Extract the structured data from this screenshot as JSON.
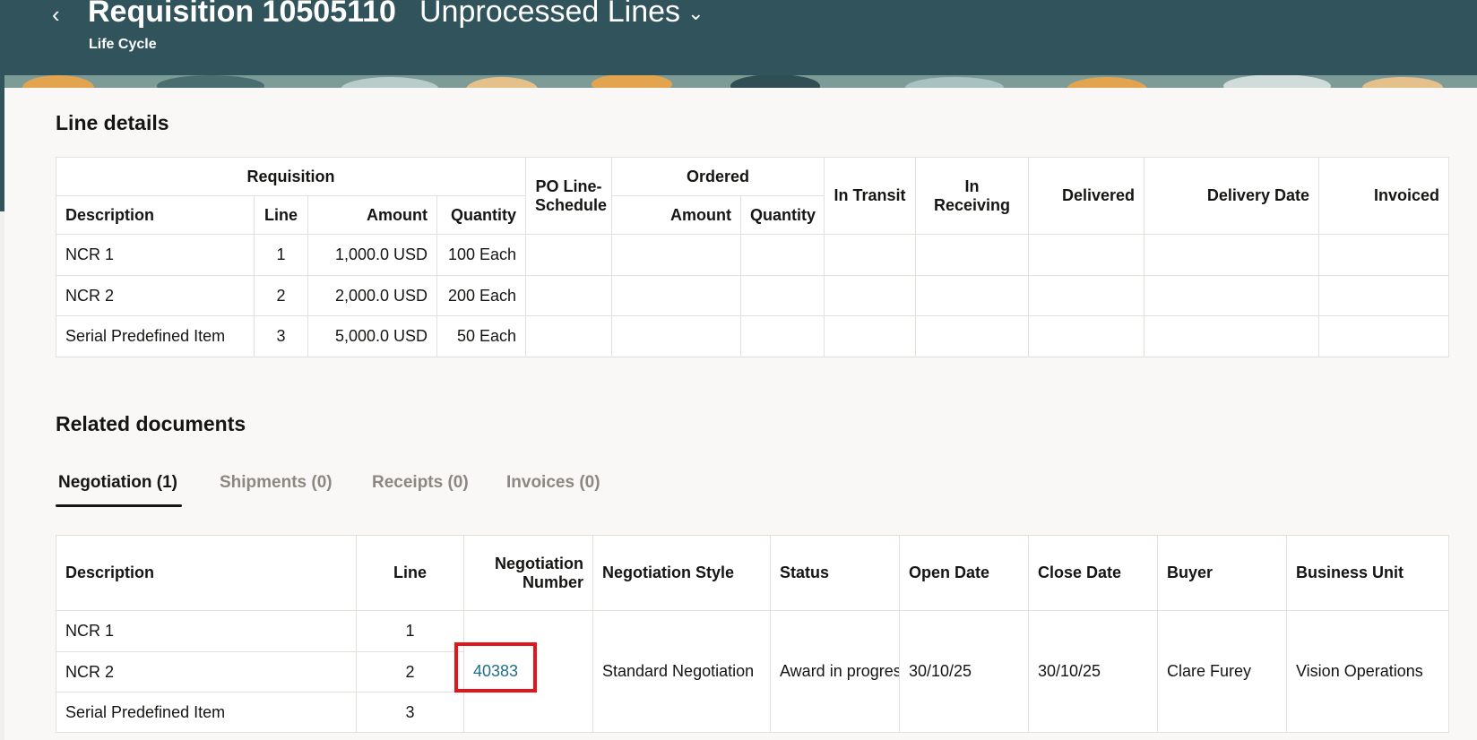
{
  "header": {
    "title": "Requisition 10505110",
    "view_selector": "Unprocessed Lines",
    "subtitle": "Life Cycle",
    "back_icon": "chevron-left-icon",
    "view_icon": "chevron-down-icon",
    "brand_color": "#31545c"
  },
  "line_details": {
    "title": "Line details",
    "group_requisition": "Requisition",
    "group_ordered": "Ordered",
    "col_description": "Description",
    "col_line": "Line",
    "col_amount": "Amount",
    "col_quantity": "Quantity",
    "col_po_line_schedule_1": "PO Line-",
    "col_po_line_schedule_2": "Schedule",
    "col_ordered_amount": "Amount",
    "col_ordered_quantity": "Quantity",
    "col_in_transit": "In Transit",
    "col_in_receiving": "In Receiving",
    "col_delivered": "Delivered",
    "col_delivery_date": "Delivery Date",
    "col_invoiced": "Invoiced",
    "rows": [
      {
        "description": "NCR 1",
        "line": "1",
        "amount": "1,000.0 USD",
        "quantity": "100 Each"
      },
      {
        "description": "NCR 2",
        "line": "2",
        "amount": "2,000.0 USD",
        "quantity": "200 Each"
      },
      {
        "description": "Serial Predefined Item",
        "line": "3",
        "amount": "5,000.0 USD",
        "quantity": "50 Each"
      }
    ]
  },
  "related": {
    "title": "Related documents",
    "tabs": [
      {
        "label": "Negotiation (1)"
      },
      {
        "label": "Shipments (0)"
      },
      {
        "label": "Receipts (0)"
      },
      {
        "label": "Invoices (0)"
      }
    ],
    "col_description": "Description",
    "col_line": "Line",
    "col_negotiation_number_1": "Negotiation",
    "col_negotiation_number_2": "Number",
    "col_style": "Negotiation Style",
    "col_status": "Status",
    "col_open_date": "Open Date",
    "col_close_date": "Close Date",
    "col_buyer": "Buyer",
    "col_business_unit": "Business Unit",
    "rows": [
      {
        "description": "NCR 1",
        "line": "1"
      },
      {
        "description": "NCR 2",
        "line": "2"
      },
      {
        "description": "Serial Predefined Item",
        "line": "3"
      }
    ],
    "negotiation_number": "40383",
    "negotiation_style": "Standard Negotiation",
    "status": "Award in progres",
    "open_date": "30/10/25",
    "close_date": "30/10/25",
    "buyer": "Clare Furey",
    "business_unit": "Vision Operations"
  }
}
